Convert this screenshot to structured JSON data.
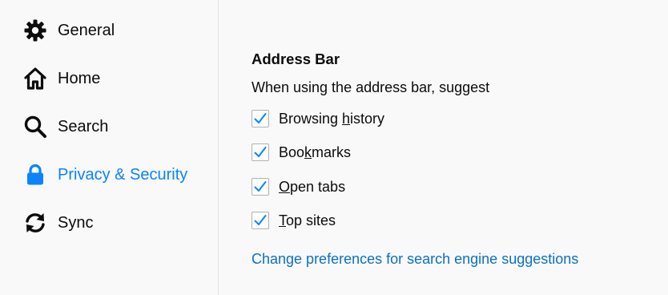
{
  "sidebar": {
    "items": [
      {
        "label": "General",
        "icon": "gear-icon",
        "selected": false
      },
      {
        "label": "Home",
        "icon": "home-icon",
        "selected": false
      },
      {
        "label": "Search",
        "icon": "search-icon",
        "selected": false
      },
      {
        "label": "Privacy & Security",
        "icon": "lock-icon",
        "selected": true
      },
      {
        "label": "Sync",
        "icon": "sync-icon",
        "selected": false
      }
    ]
  },
  "main": {
    "section_title": "Address Bar",
    "description": "When using the address bar, suggest",
    "checkboxes": [
      {
        "label_before": "Browsing ",
        "label_access": "h",
        "label_after": "istory",
        "checked": true
      },
      {
        "label_before": "Boo",
        "label_access": "k",
        "label_after": "marks",
        "checked": true
      },
      {
        "label_before": "",
        "label_access": "O",
        "label_after": "pen tabs",
        "checked": true
      },
      {
        "label_before": "",
        "label_access": "T",
        "label_after": "op sites",
        "checked": true
      }
    ],
    "link_text": "Change preferences for search engine suggestions"
  },
  "colors": {
    "accent": "#0a84ff",
    "link": "#0a70c4",
    "text": "#0c0c0d",
    "background": "#f9f9fa",
    "checkmark": "#0a84ff"
  }
}
